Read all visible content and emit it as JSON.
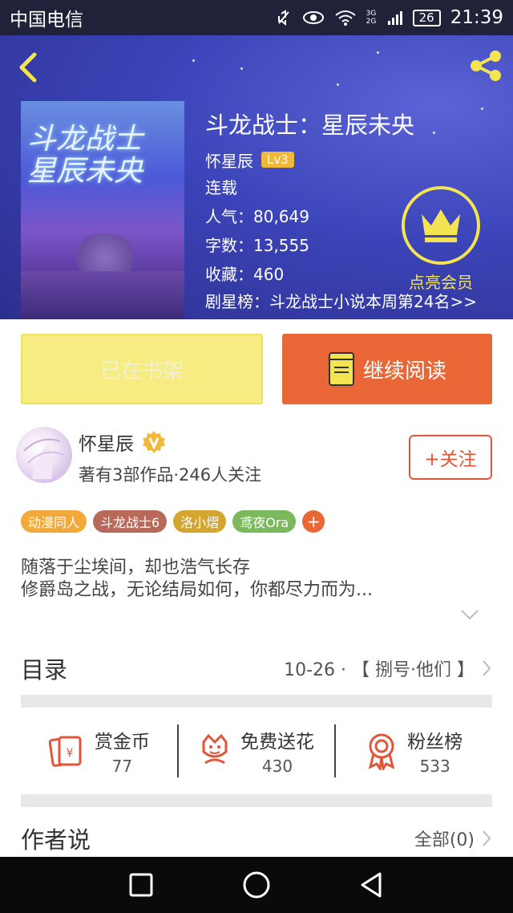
{
  "status_bar": {
    "carrier": "中国电信",
    "network": "3G 2G",
    "battery": "26",
    "time": "21:39",
    "icons": [
      "mute-icon",
      "eye-icon",
      "wifi-icon",
      "signal-icon"
    ]
  },
  "header": {
    "back_icon": "chevron-left-icon",
    "share_icon": "share-icon",
    "cover_title": "斗龙战士 星辰未央",
    "book_title": "斗龙战士：星辰未央",
    "author": "怀星辰",
    "level": "Lv3",
    "status": "连载",
    "popularity": "人气：80,649",
    "word_count": "字数：13,555",
    "favorites": "收藏：460",
    "rank": "剧星榜：斗龙战士小说本周第24名>>",
    "vip_label": "点亮会员",
    "vip_icon": "crown-icon"
  },
  "actions": {
    "shelf_label": "已在书架",
    "read_label": "继续阅读",
    "read_icon": "book-icon"
  },
  "author_block": {
    "name": "怀星辰",
    "verified_icon": "verified-v-icon",
    "stats": "著有3部作品·246人关注",
    "follow_label": "+关注"
  },
  "tags": [
    {
      "label": "动漫同人",
      "color": "#f0a93a"
    },
    {
      "label": "斗龙战士6",
      "color": "#b8695a"
    },
    {
      "label": "洛小熠",
      "color": "#d4a52f"
    },
    {
      "label": "鸢夜Ora",
      "color": "#7cb85c"
    }
  ],
  "tag_plus": "+",
  "description": {
    "line1": "随落于尘埃间，却也浩气长存",
    "line2": "修爵岛之战，无论结局如何，你都尽力而为..."
  },
  "catalog": {
    "title": "目录",
    "latest": "10-26 · 【 捌号·他们 】"
  },
  "stats": [
    {
      "label": "赏金币",
      "value": "77",
      "icon": "red-envelope-icon"
    },
    {
      "label": "免费送花",
      "value": "430",
      "icon": "flower-icon"
    },
    {
      "label": "粉丝榜",
      "value": "533",
      "icon": "medal-icon"
    }
  ],
  "author_says": {
    "title": "作者说",
    "all_label": "全部(0)"
  },
  "nav_bar": {
    "icons": [
      "recents-square-icon",
      "home-circle-icon",
      "back-triangle-icon"
    ]
  }
}
